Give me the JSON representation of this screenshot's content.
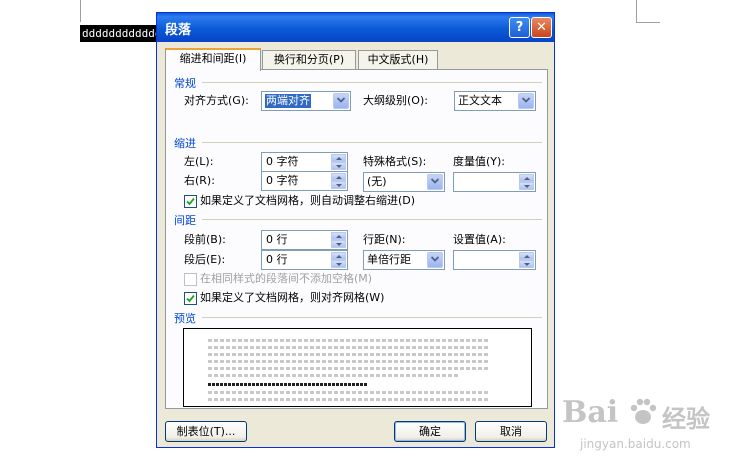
{
  "document": {
    "selected_text": "dddddddddddd"
  },
  "dialog": {
    "title": "段落",
    "help_glyph": "?",
    "close_glyph": "✕",
    "tabs": [
      {
        "label": "缩进和间距(I)",
        "active": true
      },
      {
        "label": "换行和分页(P)",
        "active": false
      },
      {
        "label": "中文版式(H)",
        "active": false
      }
    ],
    "general": {
      "title": "常规",
      "alignment_label": "对齐方式(G):",
      "alignment_value": "两端对齐",
      "outline_label": "大纲级别(O):",
      "outline_value": "正文文本"
    },
    "indent": {
      "title": "缩进",
      "left_label": "左(L):",
      "left_value": "0 字符",
      "right_label": "右(R):",
      "right_value": "0 字符",
      "special_label": "特殊格式(S):",
      "special_value": "(无)",
      "by_label": "度量值(Y):",
      "by_value": "",
      "auto_adjust_label": "如果定义了文档网格，则自动调整右缩进(D)",
      "auto_adjust_checked": true
    },
    "spacing": {
      "title": "间距",
      "before_label": "段前(B):",
      "before_value": "0 行",
      "after_label": "段后(E):",
      "after_value": "0 行",
      "line_label": "行距(N):",
      "line_value": "单倍行距",
      "at_label": "设置值(A):",
      "at_value": "",
      "no_space_same_style_label": "在相同样式的段落间不添加空格(M)",
      "no_space_same_style_checked": false,
      "snap_grid_label": "如果定义了文档网格，则对齐网格(W)",
      "snap_grid_checked": true
    },
    "preview": {
      "title": "预览"
    },
    "buttons": {
      "tabs_label": "制表位(T)...",
      "ok_label": "确定",
      "cancel_label": "取消"
    }
  },
  "watermark": {
    "brand_text": "Bai",
    "brand_suffix": "经验",
    "url": "jingyan.baidu.com"
  }
}
